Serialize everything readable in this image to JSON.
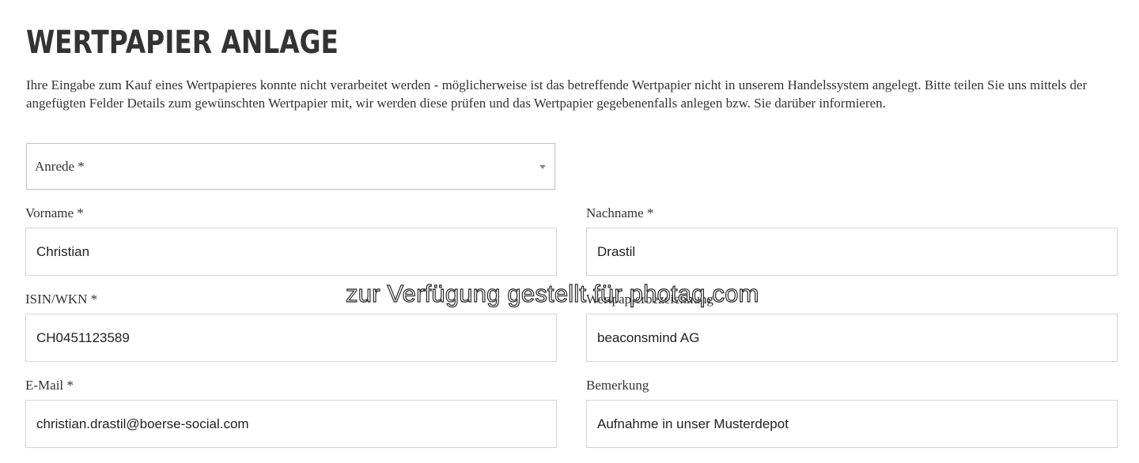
{
  "page": {
    "title": "WERTPAPIER ANLAGE",
    "intro": "Ihre Eingabe zum Kauf eines Wertpapieres konnte nicht verarbeitet werden - möglicherweise ist das betreffende Wertpapier nicht in unserem Handelssystem angelegt. Bitte teilen Sie uns mittels der angefügten Felder Details zum gewünschten Wertpapier mit, wir werden diese prüfen und das Wertpapier gegebenenfalls anlegen bzw. Sie darüber informieren."
  },
  "form": {
    "salutation": {
      "selected": "Anrede  *",
      "icon": "chevron-down-icon"
    },
    "first_name": {
      "label": "Vorname *",
      "value": "Christian"
    },
    "last_name": {
      "label": "Nachname *",
      "value": "Drastil"
    },
    "isin": {
      "label": "ISIN/WKN *",
      "value": "CH0451123589"
    },
    "security_name": {
      "label": "Wertpapierbezeichnung",
      "value": "beaconsmind AG"
    },
    "email": {
      "label": "E-Mail *",
      "value": "christian.drastil@boerse-social.com"
    },
    "remark": {
      "label": "Bemerkung",
      "value": "Aufnahme in unser Musterdepot"
    }
  },
  "watermark": {
    "text": "zur Verfügung gestellt für photaq.com"
  },
  "colors": {
    "text": "#333333",
    "border": "#d4d4d4",
    "background": "#ffffff"
  }
}
